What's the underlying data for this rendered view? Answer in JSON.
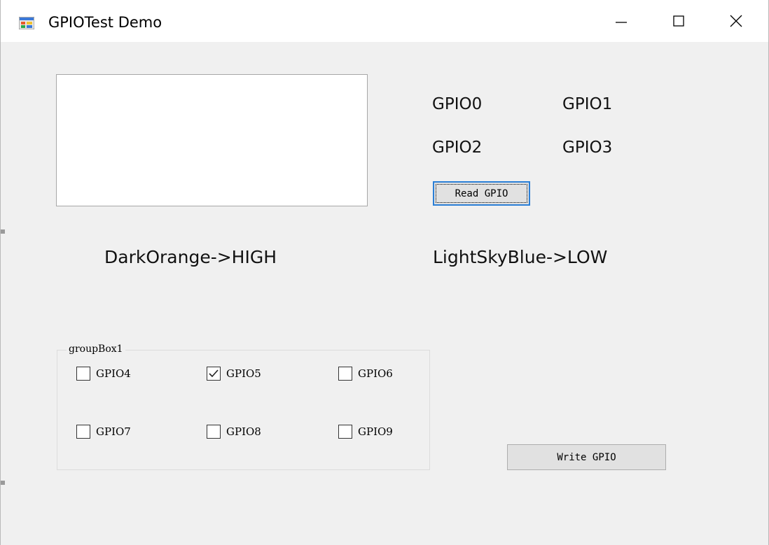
{
  "window": {
    "title": "GPIOTest Demo",
    "app_icon": "windows-app-icon",
    "controls": [
      "minimize-icon",
      "maximize-icon",
      "close-icon"
    ]
  },
  "read_panel": {
    "labels": [
      "GPIO0",
      "GPIO1",
      "GPIO2",
      "GPIO3"
    ],
    "read_button": "Read GPIO"
  },
  "legend": {
    "high": "DarkOrange->HIGH",
    "low": "LightSkyBlue->LOW"
  },
  "groupbox": {
    "title": "groupBox1",
    "checkboxes": [
      {
        "label": "GPIO4",
        "checked": false
      },
      {
        "label": "GPIO5",
        "checked": true
      },
      {
        "label": "GPIO6",
        "checked": false
      },
      {
        "label": "GPIO7",
        "checked": false
      },
      {
        "label": "GPIO8",
        "checked": false
      },
      {
        "label": "GPIO9",
        "checked": false
      }
    ]
  },
  "write_button": "Write GPIO"
}
